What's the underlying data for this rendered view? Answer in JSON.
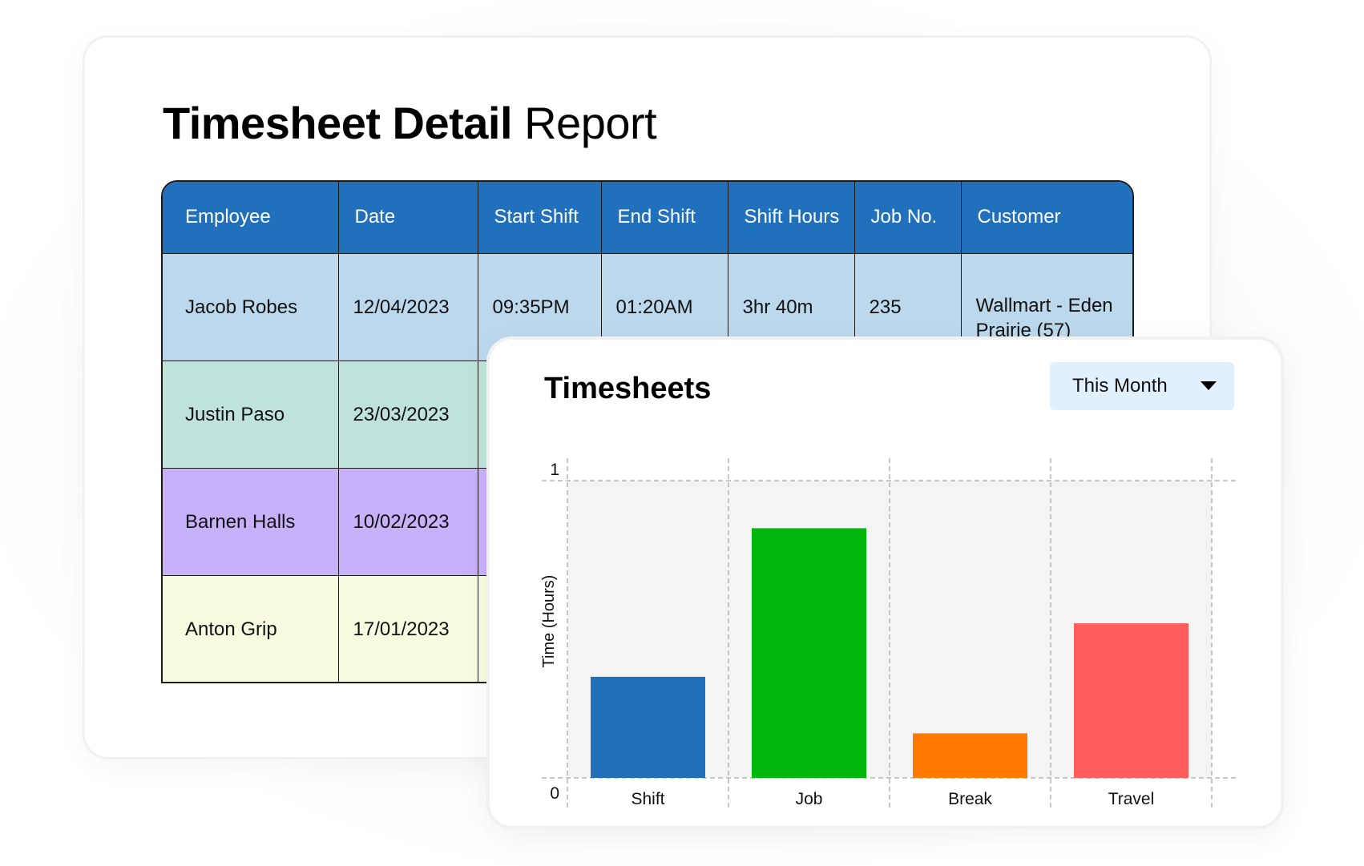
{
  "report": {
    "title_bold": "Timesheet Detail",
    "title_light": "Report",
    "columns": [
      "Employee",
      "Date",
      "Start Shift",
      "End Shift",
      "Shift Hours",
      "Job No.",
      "Customer"
    ],
    "rows": [
      {
        "employee": "Jacob Robes",
        "date": "12/04/2023",
        "start": "09:35PM",
        "end": "01:20AM",
        "hours": "3hr 40m",
        "job": "235",
        "customer": "Wallmart - Eden Prairie (57)"
      },
      {
        "employee": "Justin Paso",
        "date": "23/03/2023",
        "start": "",
        "end": "",
        "hours": "",
        "job": "",
        "customer": ""
      },
      {
        "employee": "Barnen Halls",
        "date": "10/02/2023",
        "start": "",
        "end": "",
        "hours": "",
        "job": "",
        "customer": ""
      },
      {
        "employee": "Anton Grip",
        "date": "17/01/2023",
        "start": "",
        "end": "",
        "hours": "",
        "job": "",
        "customer": ""
      }
    ],
    "colors": {
      "header": "#2170bb",
      "row_0": "#bcd8ec",
      "row_1": "#bfe3da",
      "row_2": "#c8b1fb",
      "row_3": "#f8fbe0"
    }
  },
  "timesheets": {
    "title": "Timesheets",
    "period_select": {
      "selected": "This Month",
      "icon": "caret-down-icon"
    }
  },
  "chart_data": {
    "type": "bar",
    "title": "Timesheets",
    "xlabel": "",
    "ylabel": "Time (Hours)",
    "categories": [
      "Shift",
      "Job",
      "Break",
      "Travel"
    ],
    "values": [
      0.34,
      0.84,
      0.15,
      0.52
    ],
    "colors": [
      "#2070b9",
      "#00b80d",
      "#ff7b00",
      "#ff5c5c"
    ],
    "ylim": [
      0,
      1
    ],
    "yticks": [
      "0",
      "1"
    ],
    "grid": true,
    "legend": "none"
  }
}
